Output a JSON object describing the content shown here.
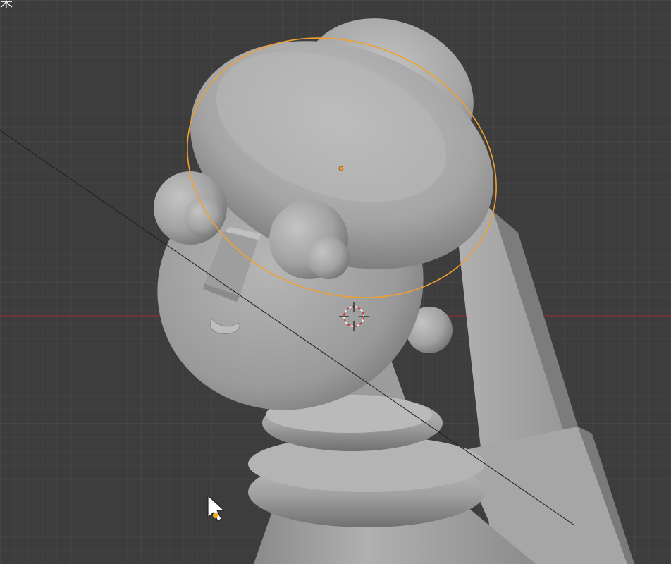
{
  "viewport": {
    "corner_glyph": "米",
    "colors": {
      "background": "#3d3d3d",
      "grid_minor": "#454545",
      "grid_major": "#4a4a4a",
      "x_axis": "#8a2f2f",
      "selection_outline": "#f0a030",
      "mesh": "#a8a8a8",
      "cursor_red": "#d23c3c",
      "cursor_white": "#f0f0f0"
    },
    "objects": [
      "hat-torus",
      "hat-top-dome",
      "head-sphere",
      "left-eye",
      "right-eye",
      "nose-box",
      "mouth",
      "earring",
      "neck",
      "collar-rings",
      "body-cone",
      "back-panel"
    ],
    "selected_object": "hat-torus",
    "cursor_icon": "mouse-pointer-icon",
    "origin_icon": "3d-cursor-icon"
  }
}
